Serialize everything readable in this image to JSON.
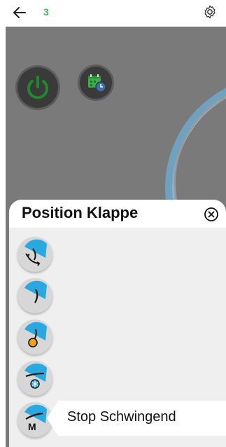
{
  "header": {
    "step_number": "3"
  },
  "panel": {
    "title": "Position Klappe",
    "options": [
      {
        "icon": "swing-arrows-icon"
      },
      {
        "icon": "flap-position-icon"
      },
      {
        "icon": "sun-heat-icon"
      },
      {
        "icon": "snowflake-cool-icon"
      },
      {
        "icon": "manual-stop-icon",
        "label": "Stop Schwingend",
        "selected": true
      }
    ]
  },
  "colors": {
    "accent_green": "#37c24a",
    "accent_blue": "#29a9df",
    "heat_orange": "#f0a500"
  }
}
